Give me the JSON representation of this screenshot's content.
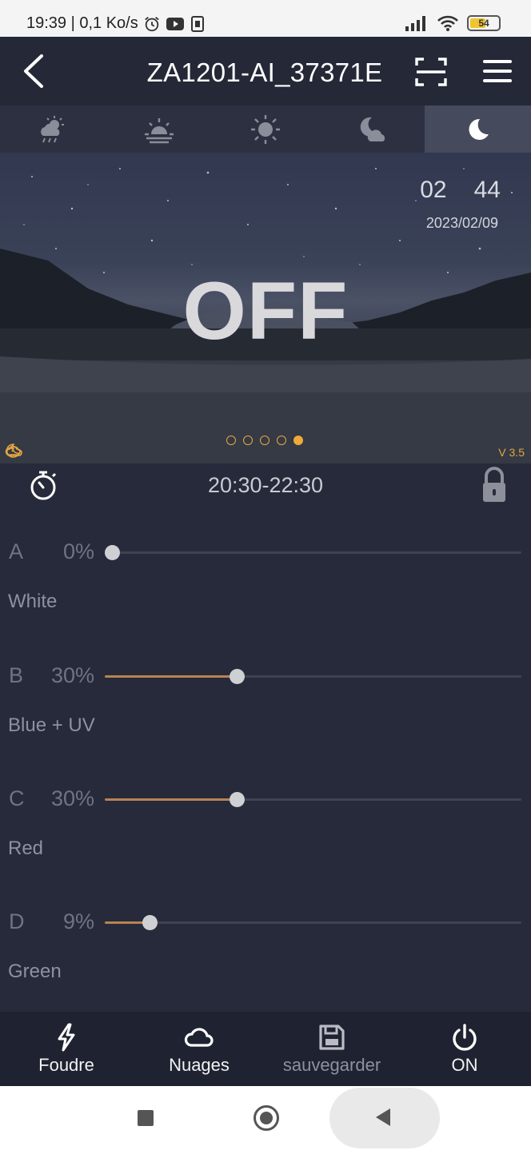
{
  "status_bar": {
    "time_info": "19:39 | 0,1 Ko/s",
    "battery_level": "54"
  },
  "header": {
    "title": "ZA1201-AI_37371E"
  },
  "mode_tabs": [
    {
      "icon": "sun-cloud-rain-icon",
      "active": false
    },
    {
      "icon": "sunrise-icon",
      "active": false
    },
    {
      "icon": "sun-icon",
      "active": false
    },
    {
      "icon": "moon-cloud-icon",
      "active": false
    },
    {
      "icon": "moon-icon",
      "active": true
    }
  ],
  "hero": {
    "clock_hours": "02",
    "clock_minutes": "44",
    "date": "2023/02/09",
    "state": "OFF",
    "version": "V 3.5",
    "page_count": 5,
    "active_page": 5
  },
  "timer": {
    "range": "20:30-22:30"
  },
  "channels": [
    {
      "letter": "A",
      "percent_label": "0%",
      "value": 0,
      "name": "White"
    },
    {
      "letter": "B",
      "percent_label": "30%",
      "value": 30,
      "name": "Blue + UV"
    },
    {
      "letter": "C",
      "percent_label": "30%",
      "value": 30,
      "name": "Red"
    },
    {
      "letter": "D",
      "percent_label": "9%",
      "value": 9,
      "name": "Green"
    }
  ],
  "toolbar": {
    "lightning_label": "Foudre",
    "clouds_label": "Nuages",
    "save_label": "sauvegarder",
    "power_label": "ON"
  },
  "colors": {
    "accent": "#f0a93b",
    "slider_fill": "#b78452",
    "background": "#262a3a"
  }
}
